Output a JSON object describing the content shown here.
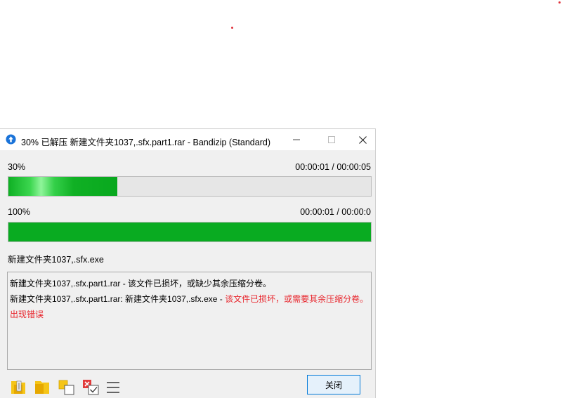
{
  "window": {
    "title": "30% 已解压 新建文件夹1037,.sfx.part1.rar - Bandizip (Standard)",
    "minimize_icon": "minimize-icon",
    "maximize_icon": "maximize-icon",
    "close_icon": "close-icon"
  },
  "progress_current": {
    "percent_label": "30%",
    "time": "00:00:01 / 00:00:05",
    "fraction": 0.3
  },
  "progress_total": {
    "percent_label": "100%",
    "time": "00:00:01 / 00:00:0",
    "fraction": 1.0
  },
  "current_file": "新建文件夹1037,.sfx.exe",
  "log": {
    "line1": "新建文件夹1037,.sfx.part1.rar - 该文件已损坏，或缺少其余压缩分卷。",
    "line2_prefix": "新建文件夹1037,.sfx.part1.rar: 新建文件夹1037,.sfx.exe - ",
    "line2_error": "该文件已损坏，或需要其余压缩分卷。",
    "line3_error": "出现错误"
  },
  "toolbar": {
    "icons": [
      "open-folder-icon",
      "folder-icon",
      "copy-icon",
      "checklist-icon",
      "menu-icon"
    ]
  },
  "buttons": {
    "close_label": "关闭"
  },
  "colors": {
    "progress_green": "#09ab21",
    "error_red": "#e8262d",
    "button_border": "#0078d7"
  }
}
